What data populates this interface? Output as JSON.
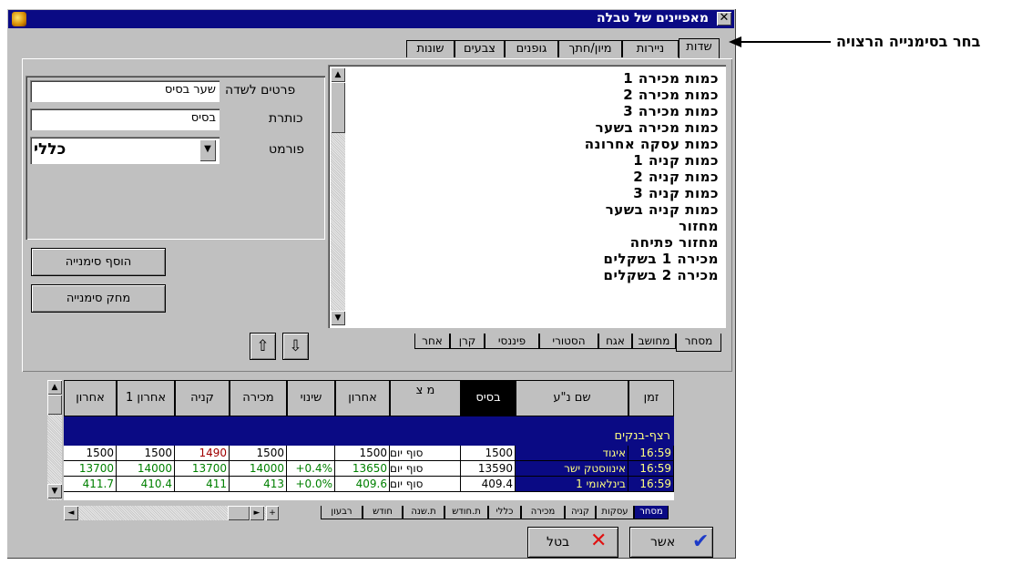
{
  "window": {
    "title": "מאפיינים של טבלה",
    "close_glyph": "✕"
  },
  "top_tabs": [
    "שדות",
    "ניירות",
    "מיון/חתך",
    "גופנים",
    "צבעים",
    "שונות"
  ],
  "callout": "בחר בסימנייה הרצויה",
  "field_props": {
    "title_label": "פרטים לשדה",
    "field_value": "שער בסיס",
    "caption_label": "כותרת",
    "caption_value": "בסיס",
    "format_label": "פורמט",
    "format_value": "כללי"
  },
  "bookmark_buttons": {
    "add": "הוסף סימנייה",
    "remove": "מחק סימנייה"
  },
  "arrows": {
    "up": "⇧",
    "down": "⇩"
  },
  "field_list": [
    "כמות מכירה 1",
    "כמות מכירה 2",
    "כמות מכירה 3",
    "כמות מכירה בשער",
    "כמות עסקה אחרונה",
    "כמות קניה 1",
    "כמות קניה 2",
    "כמות קניה 3",
    "כמות קניה בשער",
    "מחזור",
    "מחזור פתיחה",
    "מכירה 1 בשקלים",
    "מכירה 2 בשקלים"
  ],
  "list_tabs": [
    "מסחר",
    "מחושב",
    "אגח",
    "הסטורי",
    "פיננסי",
    "קרן",
    "אחר"
  ],
  "grid": {
    "headers": [
      "זמן",
      "שם נ\"ע",
      "בסיס",
      "מ צ",
      "אחרון",
      "שינוי",
      "מכירה",
      "קניה",
      "אחרון 1",
      "אחרון"
    ],
    "group_label": "רצף-בנקים",
    "rows": [
      {
        "time": "16:59",
        "name": "איגוד",
        "base": "1500",
        "kind": "סוף יום",
        "last": "1500",
        "change": "",
        "sell": "1500",
        "buy": "1490",
        "last1": "1500",
        "last2": "1500"
      },
      {
        "time": "16:59",
        "name": "אינווסטק ישר",
        "base": "13590",
        "kind": "סוף יום",
        "last": "13650",
        "change": "+0.4%",
        "sell": "14000",
        "buy": "13700",
        "last1": "14000",
        "last2": "13700"
      },
      {
        "time": "16:59",
        "name": "בינלאומי 1",
        "base": "409.4",
        "kind": "סוף יום",
        "last": "409.6",
        "change": "+0.0%",
        "sell": "413",
        "buy": "411",
        "last1": "410.4",
        "last2": "411.7"
      }
    ]
  },
  "sheet_tabs": [
    "מסחר",
    "עסקות",
    "קניה",
    "מכירה",
    "כללי",
    "ת.חודש",
    "ת.שנה",
    "חודש",
    "רבעון"
  ],
  "dialog_buttons": {
    "ok": "אשר",
    "cancel": "בטל"
  },
  "colors": {
    "title_bar": "#0a0a84",
    "selected_header": "#000000",
    "row_highlight": "#0a0a84",
    "green_text": "#008000",
    "red_text": "#a00000",
    "highlight_text": "#ffff80"
  }
}
